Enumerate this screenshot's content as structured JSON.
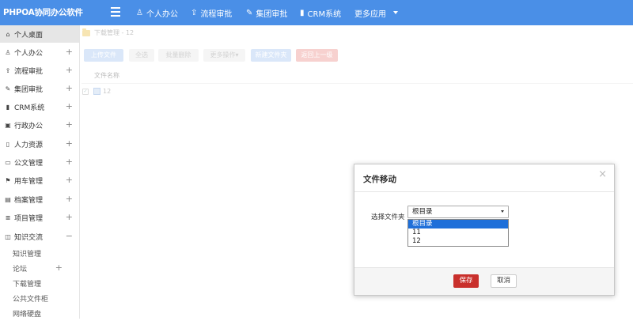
{
  "app": {
    "title": "PHPOA协同办公软件"
  },
  "topnav": [
    {
      "label": "个人办公",
      "icon": "user-icon"
    },
    {
      "label": "流程审批",
      "icon": "flow-icon"
    },
    {
      "label": "集团审批",
      "icon": "edit-icon"
    },
    {
      "label": "CRM系统",
      "icon": "bar-chart-icon"
    },
    {
      "label": "更多应用",
      "icon": "caret-down-icon"
    }
  ],
  "sidebar": {
    "items": [
      {
        "label": "个人桌面",
        "icon": "home-icon",
        "active": true
      },
      {
        "label": "个人办公",
        "icon": "user-icon"
      },
      {
        "label": "流程审批",
        "icon": "flow-icon"
      },
      {
        "label": "集团审批",
        "icon": "edit-icon"
      },
      {
        "label": "CRM系统",
        "icon": "bar-chart-icon"
      },
      {
        "label": "行政办公",
        "icon": "briefcase-icon"
      },
      {
        "label": "人力资源",
        "icon": "book-icon"
      },
      {
        "label": "公文管理",
        "icon": "folder-icon"
      },
      {
        "label": "用车管理",
        "icon": "car-icon"
      },
      {
        "label": "档案管理",
        "icon": "archive-icon"
      },
      {
        "label": "项目管理",
        "icon": "list-icon"
      },
      {
        "label": "知识交流",
        "icon": "chat-icon",
        "expanded": true
      }
    ],
    "sub_items": [
      "知识管理",
      "论坛",
      "下载管理",
      "公共文件柜",
      "网络硬盘"
    ]
  },
  "breadcrumb": "下载管理 - 12",
  "toolbar": {
    "upload": "上传文件",
    "select_all": "全选",
    "batch_delete": "批量删除",
    "more_actions": "更多操作▾",
    "new_folder": "新建文件夹",
    "back": "返回上一级"
  },
  "table": {
    "header": "文件名称",
    "rows": [
      "12"
    ]
  },
  "modal": {
    "title": "文件移动",
    "close": "×",
    "field_label": "选择文件夹",
    "selected": "根目录",
    "options": [
      "根目录",
      "11",
      "12"
    ],
    "save": "保存",
    "cancel": "取消"
  },
  "colors": {
    "topbar": "#4a8fe7",
    "option_highlight": "#1e6fd9",
    "save_button": "#c9302c"
  }
}
